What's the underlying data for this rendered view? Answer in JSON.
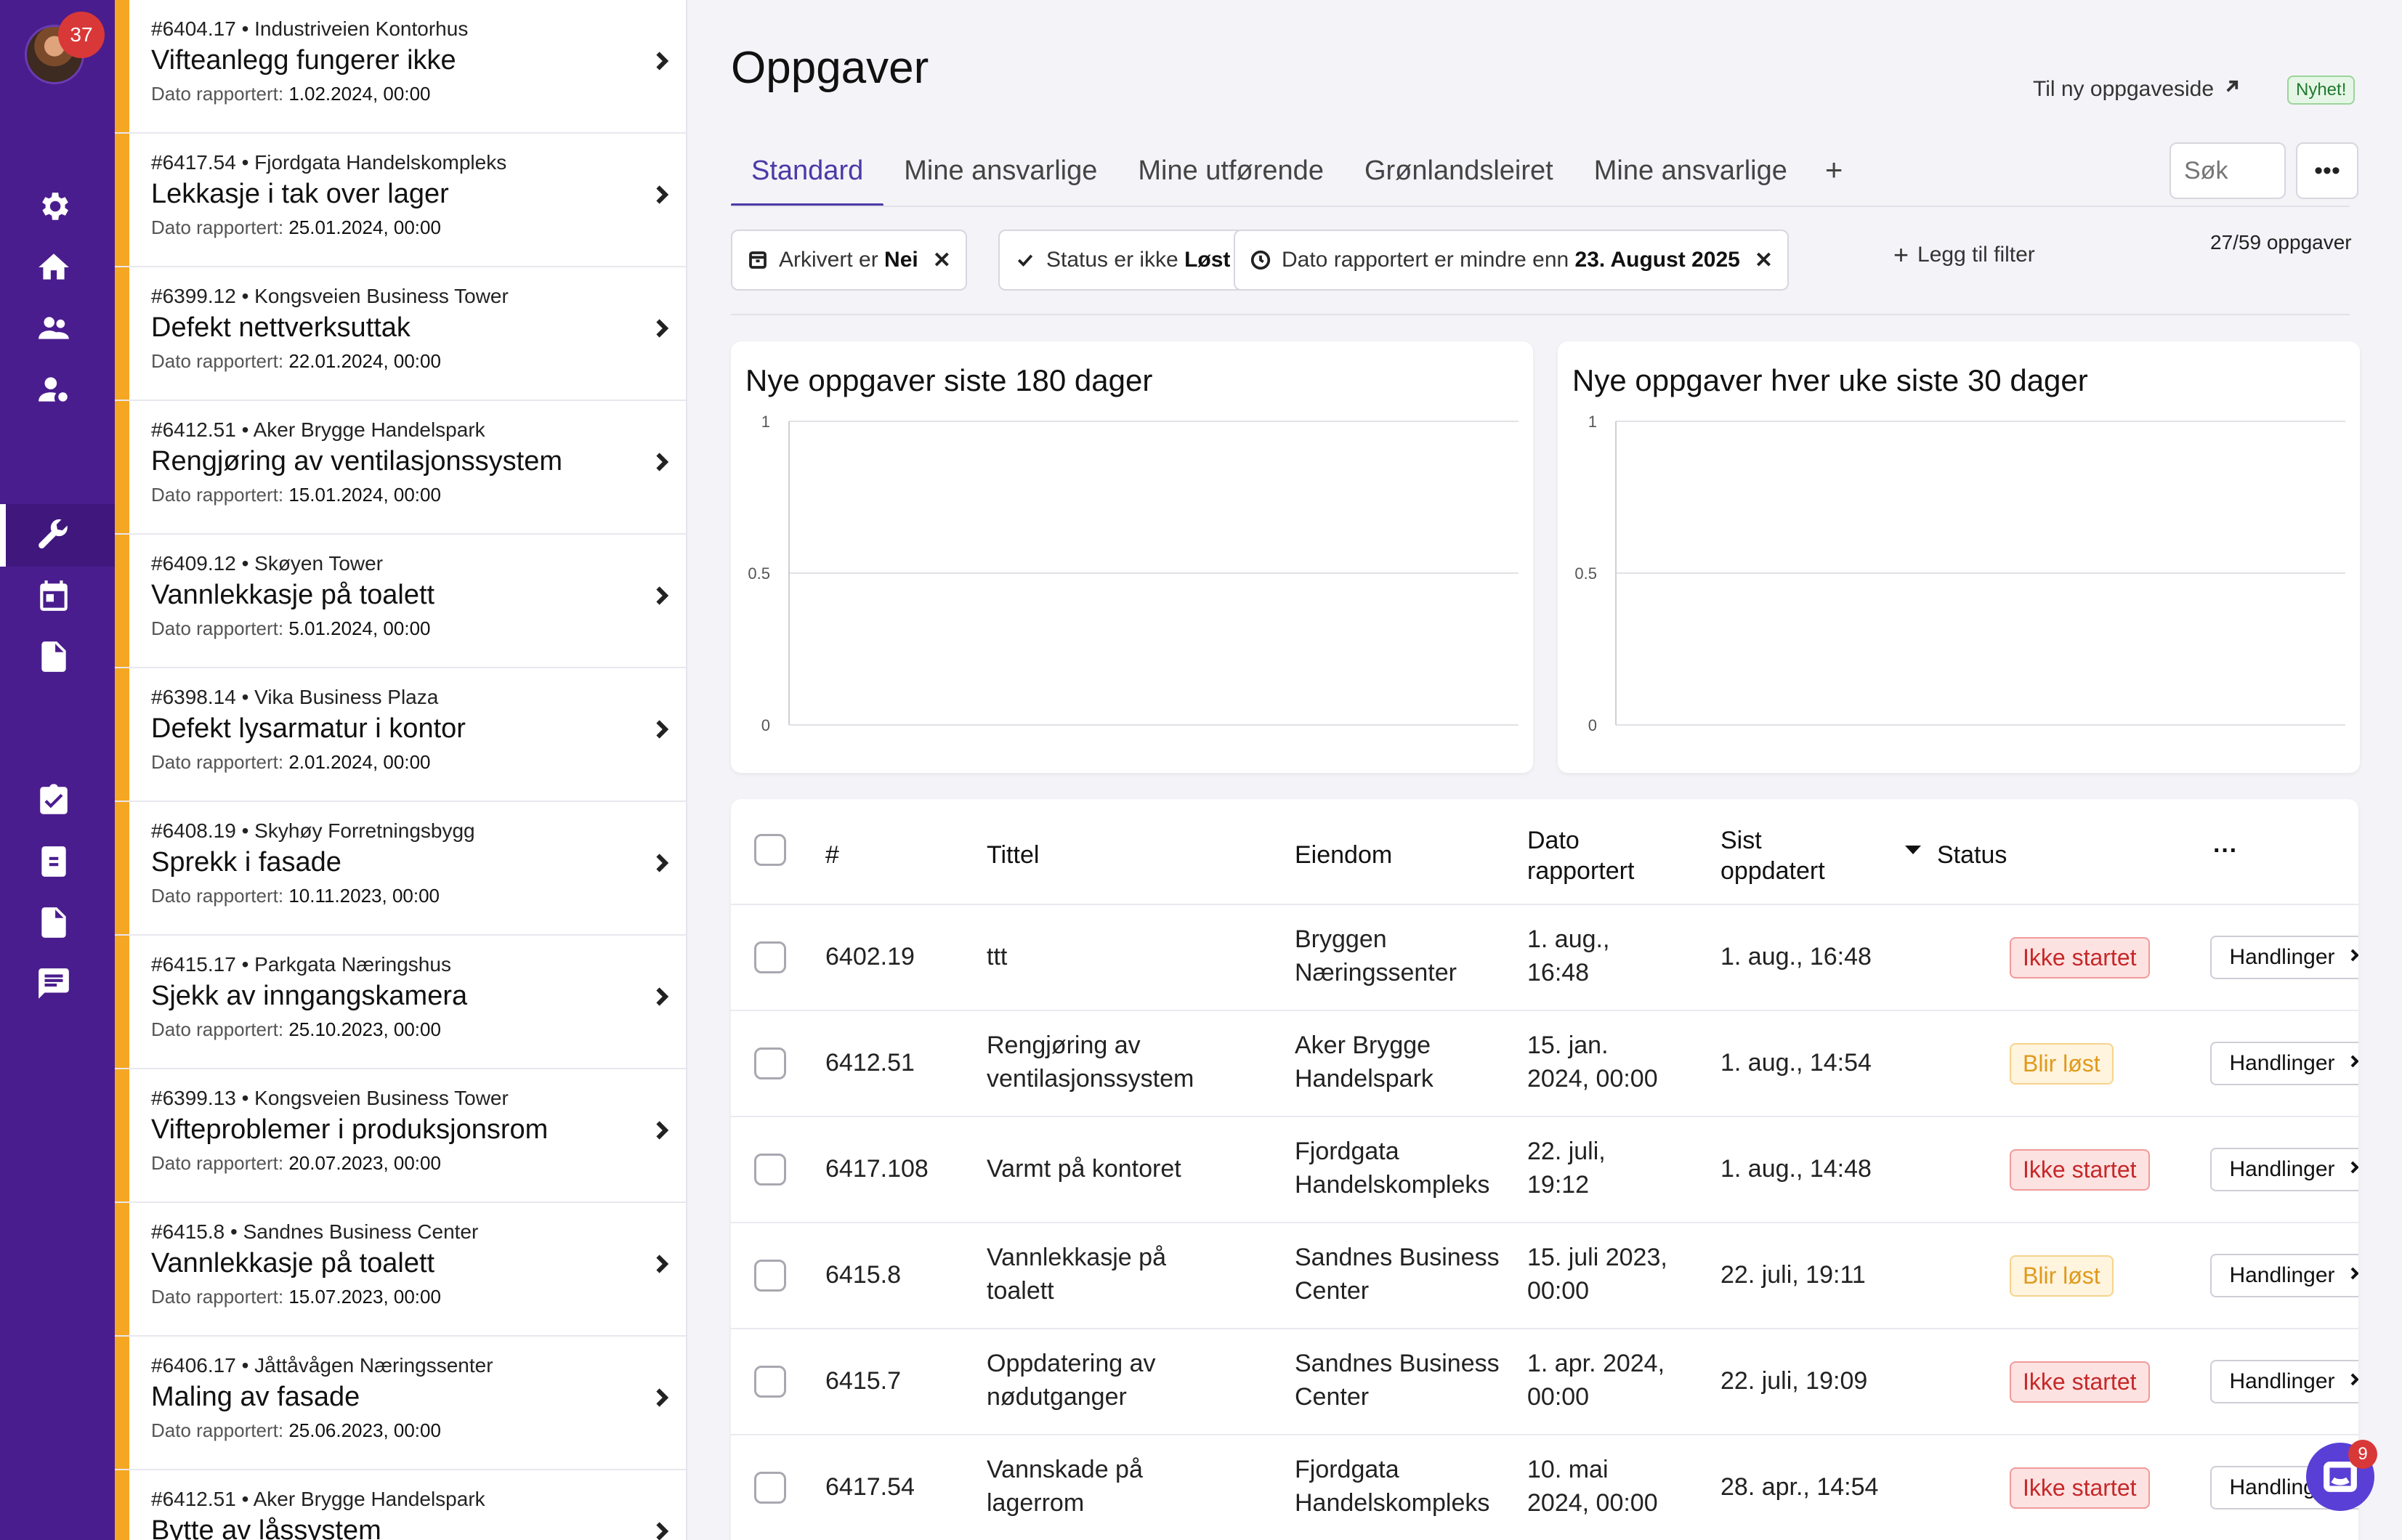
{
  "user": {
    "notification_count": "37"
  },
  "tasks": [
    {
      "meta": "#6404.17 • Industriveien Kontorhus",
      "title": "Vifteanlegg fungerer ikke",
      "date_label": "Dato rapportert: ",
      "date": "1.02.2024, 00:00"
    },
    {
      "meta": "#6417.54 • Fjordgata Handelskompleks",
      "title": "Lekkasje i tak over lager",
      "date_label": "Dato rapportert: ",
      "date": "25.01.2024, 00:00"
    },
    {
      "meta": "#6399.12 • Kongsveien Business Tower",
      "title": "Defekt nettverksuttak",
      "date_label": "Dato rapportert: ",
      "date": "22.01.2024, 00:00"
    },
    {
      "meta": "#6412.51 • Aker Brygge Handelspark",
      "title": "Rengjøring av ventilasjonssystem",
      "date_label": "Dato rapportert: ",
      "date": "15.01.2024, 00:00"
    },
    {
      "meta": "#6409.12 • Skøyen Tower",
      "title": "Vannlekkasje på toalett",
      "date_label": "Dato rapportert: ",
      "date": "5.01.2024, 00:00"
    },
    {
      "meta": "#6398.14 • Vika Business Plaza",
      "title": "Defekt lysarmatur i kontor",
      "date_label": "Dato rapportert: ",
      "date": "2.01.2024, 00:00"
    },
    {
      "meta": "#6408.19 • Skyhøy Forretningsbygg",
      "title": "Sprekk i fasade",
      "date_label": "Dato rapportert: ",
      "date": "10.11.2023, 00:00"
    },
    {
      "meta": "#6415.17 • Parkgata Næringshus",
      "title": "Sjekk av inngangskamera",
      "date_label": "Dato rapportert: ",
      "date": "25.10.2023, 00:00"
    },
    {
      "meta": "#6399.13 • Kongsveien Business Tower",
      "title": "Vifteproblemer i produksjonsrom",
      "date_label": "Dato rapportert: ",
      "date": "20.07.2023, 00:00"
    },
    {
      "meta": "#6415.8 • Sandnes Business Center",
      "title": "Vannlekkasje på toalett",
      "date_label": "Dato rapportert: ",
      "date": "15.07.2023, 00:00"
    },
    {
      "meta": "#6406.17 • Jåttåvågen Næringssenter",
      "title": "Maling av fasade",
      "date_label": "Dato rapportert: ",
      "date": "25.06.2023, 00:00"
    },
    {
      "meta": "#6412.51 • Aker Brygge Handelspark",
      "title": "Bytte av låssystem",
      "date_label": "",
      "date": ""
    }
  ],
  "header": {
    "title": "Oppgaver",
    "new_page_link": "Til ny oppgaveside",
    "new_badge": "Nyhet!"
  },
  "tabs": [
    "Standard",
    "Mine ansvarlige",
    "Mine utførende",
    "Grønlandsleiret",
    "Mine ansvarlige"
  ],
  "tab_add": "+",
  "search": {
    "placeholder": "Søk"
  },
  "filters": [
    {
      "prefix": "Arkivert er ",
      "value": "Nei",
      "icon": "archive-icon"
    },
    {
      "prefix": "Status er ikke ",
      "value": "Løst",
      "icon": "check-icon"
    },
    {
      "prefix": "Dato rapportert er mindre enn ",
      "value": "23. August 2025",
      "icon": "clock-icon"
    }
  ],
  "add_filter": "Legg til filter",
  "task_count": "27/59 oppgaver",
  "chart_data": [
    {
      "type": "line",
      "title": "Nye oppgaver siste 180 dager",
      "xlabel": "",
      "ylabel": "",
      "ylim": [
        0,
        1
      ],
      "yticks": [
        "1",
        "0.5",
        "0"
      ],
      "grid": true,
      "series": []
    },
    {
      "type": "line",
      "title": "Nye oppgaver hver uke siste 30 dager",
      "xlabel": "",
      "ylabel": "",
      "ylim": [
        0,
        1
      ],
      "yticks": [
        "1",
        "0.5",
        "0"
      ],
      "grid": true,
      "series": []
    }
  ],
  "table": {
    "headers": {
      "num": "#",
      "title": "Tittel",
      "property": "Eiendom",
      "reported": [
        "Dato",
        "rapportert"
      ],
      "updated": [
        "Sist",
        "oppdatert"
      ],
      "status": "Status",
      "more": "···"
    },
    "actions_label": "Handlinger",
    "rows": [
      {
        "num": "6402.19",
        "title": [
          "ttt"
        ],
        "property": [
          "Bryggen",
          "Næringssenter"
        ],
        "reported": [
          "1. aug.,",
          "16:48"
        ],
        "updated": "1. aug., 16:48",
        "status": "Ikke startet",
        "status_color": "#c62828"
      },
      {
        "num": "6412.51",
        "title": [
          "Rengjøring av",
          "ventilasjonssystem"
        ],
        "property": [
          "Aker Brygge",
          "Handelspark"
        ],
        "reported": [
          "15. jan.",
          "2024, 00:00"
        ],
        "updated": "1. aug., 14:54",
        "status": "Blir løst",
        "status_color": "#e09a1c"
      },
      {
        "num": "6417.108",
        "title": [
          "Varmt på kontoret"
        ],
        "property": [
          "Fjordgata",
          "Handelskompleks"
        ],
        "reported": [
          "22. juli,",
          "19:12"
        ],
        "updated": "1. aug., 14:48",
        "status": "Ikke startet",
        "status_color": "#c62828"
      },
      {
        "num": "6415.8",
        "title": [
          "Vannlekkasje på",
          "toalett"
        ],
        "property": [
          "Sandnes Business",
          "Center"
        ],
        "reported": [
          "15. juli 2023,",
          "00:00"
        ],
        "updated": "22. juli, 19:11",
        "status": "Blir løst",
        "status_color": "#e09a1c"
      },
      {
        "num": "6415.7",
        "title": [
          "Oppdatering av",
          "nødutganger"
        ],
        "property": [
          "Sandnes Business",
          "Center"
        ],
        "reported": [
          "1. apr. 2024,",
          "00:00"
        ],
        "updated": "22. juli, 19:09",
        "status": "Ikke startet",
        "status_color": "#c62828"
      },
      {
        "num": "6417.54",
        "title": [
          "Vannskade på",
          "lagerrom"
        ],
        "property": [
          "Fjordgata",
          "Handelskompleks"
        ],
        "reported": [
          "10. mai",
          "2024, 00:00"
        ],
        "updated": "28. apr., 14:54",
        "status": "Ikke startet",
        "status_color": "#c62828"
      }
    ]
  },
  "chat": {
    "badge": "9"
  },
  "colors": {
    "rail": "#4a1d8e",
    "accent": "#4a3aa8",
    "task_stripe": "#f5a623"
  }
}
